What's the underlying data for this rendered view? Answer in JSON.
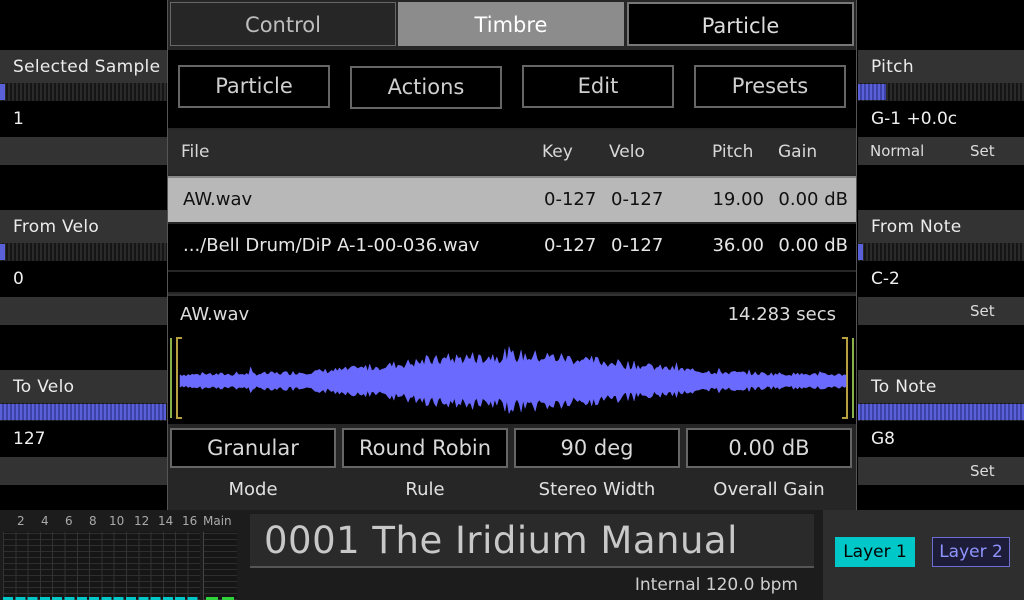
{
  "tabs": [
    "Control",
    "Timbre",
    "Particle"
  ],
  "subtabs": [
    "Particle",
    "Actions",
    "Edit",
    "Presets"
  ],
  "table": {
    "headers": {
      "file": "File",
      "key": "Key",
      "velo": "Velo",
      "pitch": "Pitch",
      "gain": "Gain"
    },
    "rows": [
      {
        "file": "AW.wav",
        "key": "0-127",
        "velo": "0-127",
        "pitch": "19.00",
        "gain": "0.00 dB"
      },
      {
        "file": ".../Bell Drum/DiP A-1-00-036.wav",
        "key": "0-127",
        "velo": "0-127",
        "pitch": "36.00",
        "gain": "0.00 dB"
      }
    ]
  },
  "waveform": {
    "name": "AW.wav",
    "length": "14.283 secs",
    "color": "#6a6aff"
  },
  "params": [
    {
      "value": "Granular",
      "label": "Mode"
    },
    {
      "value": "Round Robin",
      "label": "Rule"
    },
    {
      "value": "90 deg",
      "label": "Stereo Width"
    },
    {
      "value": "0.00 dB",
      "label": "Overall Gain"
    }
  ],
  "left": {
    "selected_sample": {
      "title": "Selected Sample",
      "value": "1",
      "level": 0.02
    },
    "from_velo": {
      "title": "From Velo",
      "value": "0",
      "level": 0.0
    },
    "to_velo": {
      "title": "To Velo",
      "value": "127",
      "level": 1.0
    }
  },
  "right": {
    "pitch": {
      "title": "Pitch",
      "value": "G-1 +0.0c",
      "mode": "Normal",
      "set": "Set",
      "level": 0.17
    },
    "from_note": {
      "title": "From Note",
      "value": "C-2",
      "set": "Set",
      "level": 0.0
    },
    "to_note": {
      "title": "To Note",
      "value": "G8",
      "set": "Set",
      "level": 1.0
    }
  },
  "meter": {
    "labels": [
      "2",
      "4",
      "6",
      "8",
      "10",
      "12",
      "14",
      "16"
    ],
    "main_label": "Main"
  },
  "patch": {
    "name": "0001 The Iridium Manual",
    "tempo": "Internal 120.0 bpm"
  },
  "layers": [
    "Layer 1",
    "Layer 2"
  ],
  "colors": {
    "accent": "#5a61d8",
    "layer_active": "#00c8c8",
    "waveform": "#6a6aff"
  }
}
